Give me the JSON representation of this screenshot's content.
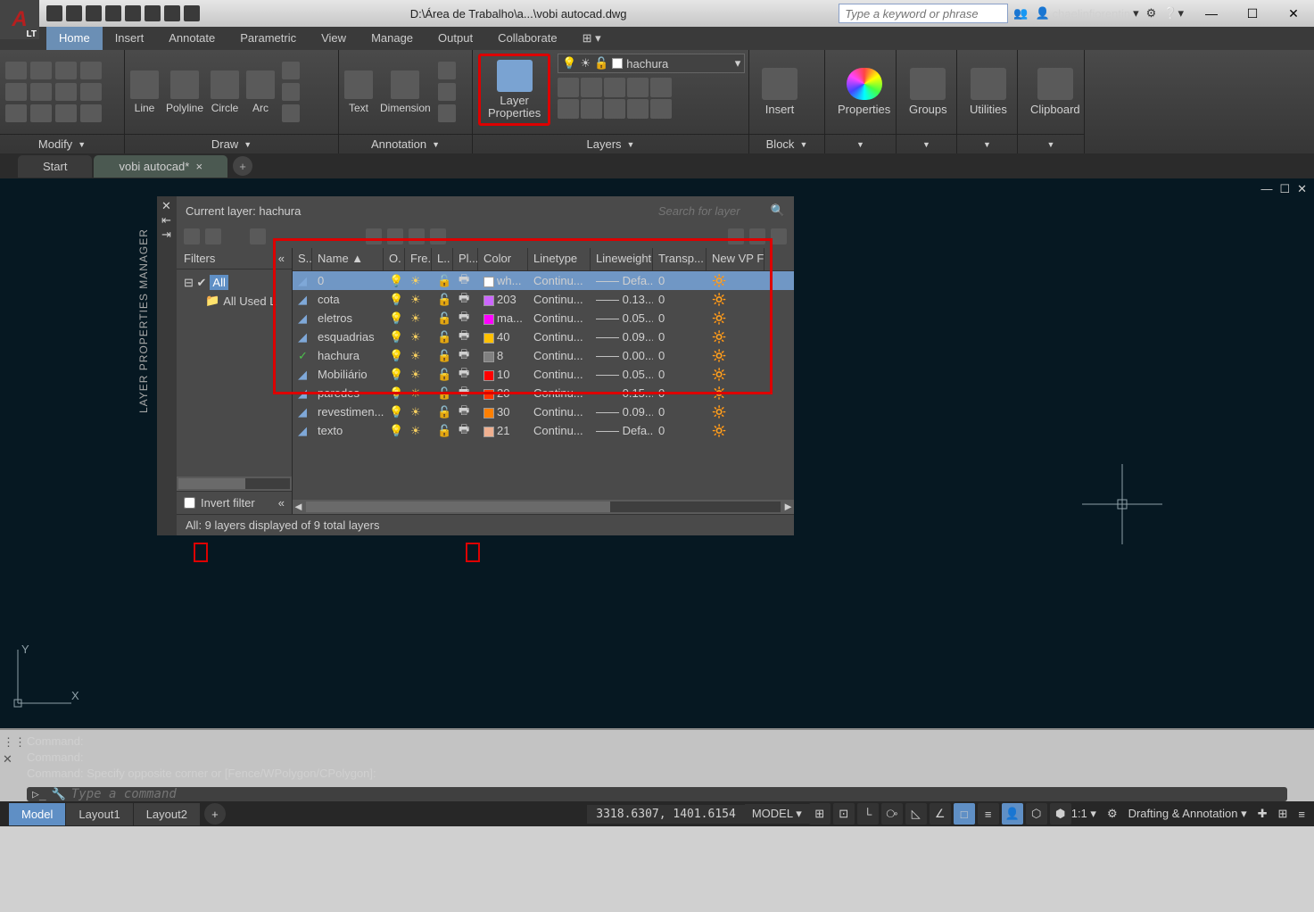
{
  "title_path": "D:\\Área de Trabalho\\a...\\vobi autocad.dwg",
  "search_box_placeholder": "Type a keyword or phrase",
  "user_name": "chaelinfiorentin",
  "menu_tabs": [
    "Home",
    "Insert",
    "Annotate",
    "Parametric",
    "View",
    "Manage",
    "Output",
    "Collaborate"
  ],
  "ribbon": {
    "modify": "Modify",
    "draw": "Draw",
    "annotation": "Annotation",
    "layers": "Layers",
    "block": "Block",
    "line": "Line",
    "polyline": "Polyline",
    "circle": "Circle",
    "arc": "Arc",
    "text": "Text",
    "dimension": "Dimension",
    "layer_props": "Layer Properties",
    "insert": "Insert",
    "properties": "Properties",
    "groups": "Groups",
    "utilities": "Utilities",
    "clipboard": "Clipboard",
    "current_layer_drop": "hachura"
  },
  "doc_tabs": {
    "start": "Start",
    "active": "vobi autocad*"
  },
  "palette": {
    "title": "LAYER PROPERTIES MANAGER",
    "current": "Current layer: hachura",
    "search_ph": "Search for layer",
    "filters_header": "Filters",
    "filter_all": "All",
    "filter_used": "All Used L",
    "invert_label": "Invert filter",
    "columns": {
      "s": "S..",
      "name": "Name",
      "on": "O.",
      "fr": "Fre...",
      "lo": "L..",
      "pl": "Pl...",
      "color": "Color",
      "lt": "Linetype",
      "lw": "Lineweight",
      "tr": "Transp...",
      "nvp": "New VP F..."
    },
    "layers": [
      {
        "selected": true,
        "current": false,
        "name": "0",
        "color": "#ffffff",
        "colortext": "wh...",
        "linetype": "Continu...",
        "lineweight": "Defa...",
        "transp": "0"
      },
      {
        "current": false,
        "name": "cota",
        "color": "#cc66ff",
        "colortext": "203",
        "linetype": "Continu...",
        "lineweight": "0.13...",
        "transp": "0"
      },
      {
        "current": false,
        "name": "eletros",
        "color": "#ff00ff",
        "colortext": "ma...",
        "linetype": "Continu...",
        "lineweight": "0.05...",
        "transp": "0"
      },
      {
        "current": false,
        "name": "esquadrias",
        "color": "#ffc000",
        "colortext": "40",
        "linetype": "Continu...",
        "lineweight": "0.09...",
        "transp": "0"
      },
      {
        "current": true,
        "name": "hachura",
        "color": "#808080",
        "colortext": "8",
        "linetype": "Continu...",
        "lineweight": "0.00...",
        "transp": "0"
      },
      {
        "current": false,
        "name": "Mobiliário",
        "color": "#ff0000",
        "colortext": "10",
        "linetype": "Continu...",
        "lineweight": "0.05...",
        "transp": "0"
      },
      {
        "current": false,
        "name": "paredes",
        "color": "#ff3300",
        "colortext": "20",
        "linetype": "Continu...",
        "lineweight": "0.15...",
        "transp": "0"
      },
      {
        "current": false,
        "name": "revestimen...",
        "color": "#ff8000",
        "colortext": "30",
        "linetype": "Continu...",
        "lineweight": "0.09...",
        "transp": "0"
      },
      {
        "current": false,
        "name": "texto",
        "color": "#f0b090",
        "colortext": "21",
        "linetype": "Continu...",
        "lineweight": "Defa...",
        "transp": "0"
      }
    ],
    "status": "All: 9 layers displayed of 9 total layers"
  },
  "cmd": {
    "line1": "Command:",
    "line2": "Command:",
    "line3": "Command: Specify opposite corner or [Fence/WPolygon/CPolygon]:",
    "placeholder": "Type a command"
  },
  "statusbar": {
    "tabs": [
      "Model",
      "Layout1",
      "Layout2"
    ],
    "coords": "3318.6307, 1401.6154",
    "model": "MODEL",
    "scale": "1:1",
    "workspace": "Drafting & Annotation"
  }
}
